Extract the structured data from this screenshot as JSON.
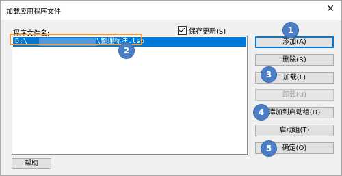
{
  "window": {
    "title": "加载应用程序文件",
    "close_glyph": "✕"
  },
  "file_list": {
    "label": "程序文件名:",
    "items": [
      {
        "drive": "D:\\",
        "name": "\\整理标注.lsp"
      }
    ]
  },
  "save_changes": {
    "label": "保存更新(S)",
    "checked": true
  },
  "buttons": {
    "add": "添加(A)",
    "remove": "删除(R)",
    "load": "加载(L)",
    "unload": "卸载(U)",
    "add_to_startup": "添加到启动组(D)",
    "startup_group": "启动组(T)",
    "ok": "确定(O)",
    "help": "帮助"
  },
  "badges": [
    "1",
    "2",
    "3",
    "4",
    "5"
  ],
  "colors": {
    "selection": "#0078d7",
    "highlight_box": "#f39c3c",
    "badge": "#4a7fc6"
  }
}
